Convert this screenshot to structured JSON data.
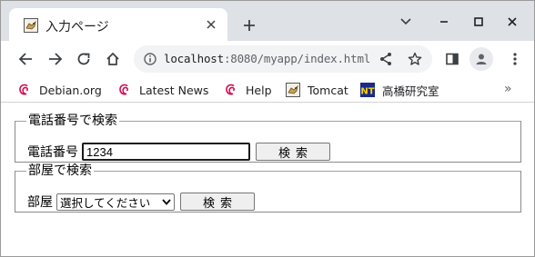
{
  "browser": {
    "tab": {
      "title": "入力ページ",
      "favicon": "tomcat-favicon-icon"
    },
    "new_tab_label": "+",
    "url": {
      "host": "localhost",
      "rest": ":8080/myapp/index.html"
    },
    "bookmarks": [
      {
        "label": "Debian.org",
        "icon": "debian-icon"
      },
      {
        "label": "Latest News",
        "icon": "debian-icon"
      },
      {
        "label": "Help",
        "icon": "debian-icon"
      },
      {
        "label": "Tomcat",
        "icon": "tomcat-icon"
      },
      {
        "label": "高橋研究室",
        "icon": "nt-icon",
        "icon_text": "NT"
      }
    ],
    "bookmarks_more": "»"
  },
  "page": {
    "phone_search": {
      "legend": "電話番号で検索",
      "label": "電話番号",
      "value": "1234",
      "button": "検索"
    },
    "room_search": {
      "legend": "部屋で検索",
      "label": "部屋",
      "selected": "選択してください",
      "button": "検索"
    }
  },
  "colors": {
    "tabstrip": "#dee1e6",
    "debian_red": "#d70751",
    "nt_bg": "#1a2b8c",
    "nt_fg": "#f5d20a"
  }
}
